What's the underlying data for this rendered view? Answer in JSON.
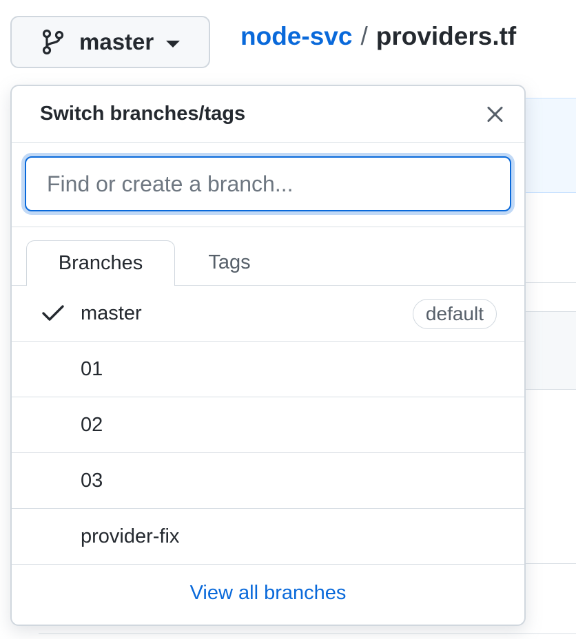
{
  "branch_button": {
    "label": "master",
    "icon": "git-branch-icon"
  },
  "breadcrumb": {
    "repo": "node-svc",
    "separator": "/",
    "file": "providers.tf"
  },
  "dropdown": {
    "title": "Switch branches/tags",
    "close_icon": "close-icon",
    "filter": {
      "placeholder": "Find or create a branch...",
      "value": ""
    },
    "tabs": [
      {
        "label": "Branches",
        "selected": true
      },
      {
        "label": "Tags",
        "selected": false
      }
    ],
    "branches": [
      {
        "name": "master",
        "checked": true,
        "badge": "default"
      },
      {
        "name": "01",
        "checked": false
      },
      {
        "name": "02",
        "checked": false
      },
      {
        "name": "03",
        "checked": false
      },
      {
        "name": "provider-fix",
        "checked": false
      }
    ],
    "footer_link": "View all branches"
  },
  "colors": {
    "accent": "#0969da",
    "text": "#24292f",
    "muted": "#57606a",
    "border": "#d0d7de",
    "button_bg": "#f6f8fa"
  }
}
